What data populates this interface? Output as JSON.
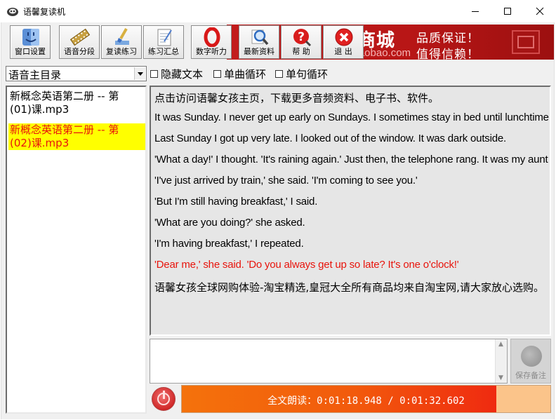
{
  "window": {
    "title": "语馨复读机",
    "controls": [
      "minimize",
      "maximize",
      "close"
    ]
  },
  "toolbar": {
    "buttons": [
      {
        "label": "窗口设置",
        "icon": "finder-face-icon"
      },
      {
        "label": "语音分段",
        "icon": "film-strip-icon"
      },
      {
        "label": "复读练习",
        "icon": "paint-brush-icon"
      },
      {
        "label": "练习汇总",
        "icon": "notepad-icon"
      },
      {
        "label": "数字听力",
        "icon": "number-zero-icon"
      },
      {
        "label": "最新资料",
        "icon": "magnifier-icon"
      },
      {
        "label": "帮 助",
        "icon": "question-icon"
      },
      {
        "label": "退 出",
        "icon": "close-x-icon"
      }
    ]
  },
  "banner": {
    "city": "商城",
    "url": "mall.taobao.com",
    "slogan1": "品质保证！",
    "slogan2": "值得信赖！",
    "bg_color": "#c21c1c"
  },
  "directory": {
    "selected": "语音主目录"
  },
  "options": [
    {
      "label": "隐藏文本",
      "checked": false
    },
    {
      "label": "单曲循环",
      "checked": false
    },
    {
      "label": "单句循环",
      "checked": false
    }
  ],
  "playlist": {
    "items": [
      {
        "line1": "新概念英语第二册 -- 第",
        "line2": "(01)课.mp3",
        "selected": false
      },
      {
        "line1": "新概念英语第二册 -- 第",
        "line2": "(02)课.mp3",
        "selected": true
      }
    ]
  },
  "text": {
    "lines": [
      "点击访问语馨女孩主页，下载更多音频资料、电子书、软件。",
      "It was Sunday. I never get up early on Sundays. I sometimes stay in bed until lunchtime.",
      "Last Sunday I got up very late. I looked out of the window. It was dark outside.",
      "'What a day!' I thought. 'It's raining again.' Just then, the telephone rang. It was my aunt Lucy.",
      "'I've just arrived by train,' she said. 'I'm coming to see you.'",
      "'But I'm still having breakfast,' I said.",
      "'What are you doing?' she asked.",
      "'I'm having breakfast,' I repeated.",
      "'Dear me,' she said. 'Do you always get up so late? It's one o'clock!'",
      "语馨女孩全球网购体验-淘宝精选,皇冠大全所有商品均来自淘宝网,请大家放心选购。"
    ],
    "active_index": 8,
    "active_color": "#e8140c"
  },
  "notes": {
    "value": "",
    "save_label": "保存备注"
  },
  "playback": {
    "label": "全文朗读：0:01:18.948 / 0:01:32.602",
    "progress_fraction": 0.853
  }
}
